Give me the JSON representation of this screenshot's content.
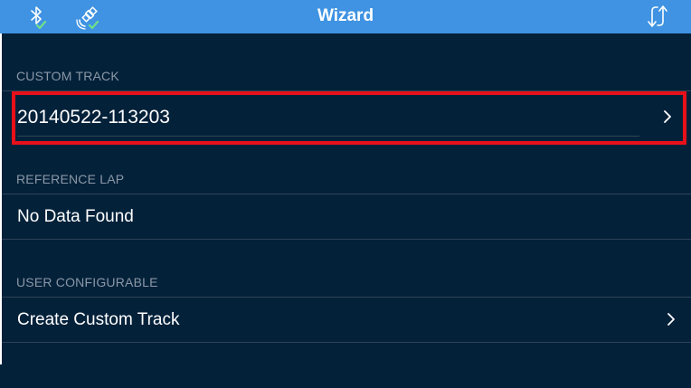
{
  "navbar": {
    "title": "Wizard",
    "left_icons": [
      "bluetooth-icon",
      "satellite-icon"
    ],
    "right_icon": "sync-arrows-icon",
    "color": "#3f93e2",
    "status_check_color": "#6fe08a"
  },
  "sections": [
    {
      "header": "CUSTOM TRACK",
      "rows": [
        {
          "label": "20140522-113203",
          "has_chevron": true,
          "highlighted": true
        }
      ]
    },
    {
      "header": "REFERENCE LAP",
      "rows": [
        {
          "label": "No Data Found",
          "has_chevron": false
        }
      ]
    },
    {
      "header": "USER CONFIGURABLE",
      "rows": [
        {
          "label": "Create Custom Track",
          "has_chevron": true
        }
      ]
    }
  ],
  "colors": {
    "background": "#04213a",
    "highlight_border": "#e8101a",
    "header_text": "#8a98a6"
  }
}
